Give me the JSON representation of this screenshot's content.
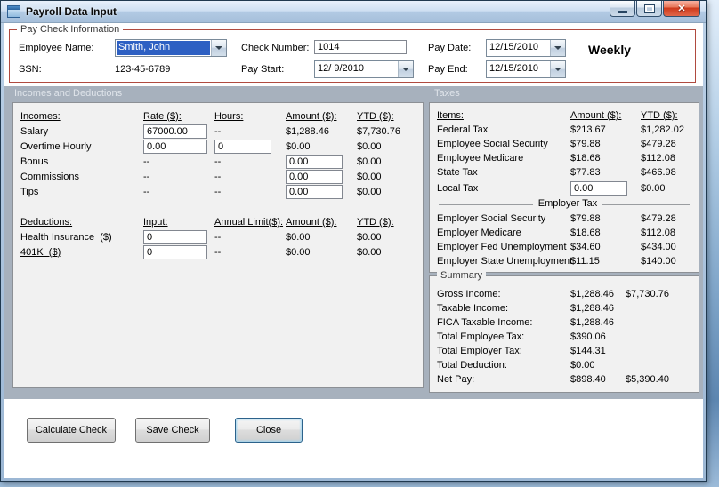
{
  "colors": {
    "desktop_blue": "#7fa5c9",
    "titlebar_top": "#e7f0fb",
    "band_background": "#a7b1bd",
    "panel_background": "#f1f1f1",
    "paycheck_group_border": "#b04a3f",
    "selection_blue": "#2e60c3",
    "close_button_red": "#ce3a1c"
  },
  "window": {
    "title": "Payroll Data Input"
  },
  "icons": {
    "close_glyph": "✕"
  },
  "paycheck": {
    "group_label": "Pay Check Information",
    "fields": {
      "employee_name": {
        "label": "Employee Name:",
        "value": "Smith, John"
      },
      "ssn": {
        "label": "SSN:",
        "value": "123-45-6789"
      },
      "check_number": {
        "label": "Check Number:",
        "value": "1014"
      },
      "pay_start": {
        "label": "Pay Start:",
        "value": "12/ 9/2010"
      },
      "pay_date": {
        "label": "Pay Date:",
        "value": "12/15/2010"
      },
      "pay_end": {
        "label": "Pay End:",
        "value": "12/15/2010"
      }
    },
    "frequency": "Weekly"
  },
  "sections": {
    "incomes_and_deductions": "Incomes and Deductions",
    "taxes": "Taxes"
  },
  "incomes": {
    "headers": {
      "name": "Incomes:",
      "rate": "Rate ($):",
      "hours": "Hours:",
      "amount": "Amount ($):",
      "ytd": "YTD ($):"
    },
    "rows": [
      {
        "label": "Salary",
        "rate": "67000.00",
        "hours": "--",
        "amount": "$1,288.46",
        "ytd": "$7,730.76"
      },
      {
        "label": "Overtime Hourly",
        "rate": "0.00",
        "hours": "0",
        "amount": "$0.00",
        "ytd": "$0.00"
      },
      {
        "label": "Bonus",
        "rate": "--",
        "hours": "--",
        "amount": "0.00",
        "ytd": "$0.00"
      },
      {
        "label": "Commissions",
        "rate": "--",
        "hours": "--",
        "amount": "0.00",
        "ytd": "$0.00"
      },
      {
        "label": "Tips",
        "rate": "--",
        "hours": "--",
        "amount": "0.00",
        "ytd": "$0.00"
      }
    ]
  },
  "deductions": {
    "headers": {
      "name": "Deductions:",
      "input": "Input:",
      "annual_limit": "Annual Limit($):",
      "amount": "Amount ($):",
      "ytd": "YTD ($):"
    },
    "rows": [
      {
        "label": "Health Insurance  ($)",
        "input": "0",
        "annual_limit": "--",
        "amount": "$0.00",
        "ytd": "$0.00"
      },
      {
        "label": "401K  ($)",
        "input": "0",
        "annual_limit": "--",
        "amount": "$0.00",
        "ytd": "$0.00"
      }
    ]
  },
  "taxes": {
    "headers": {
      "items": "Items:",
      "amount": "Amount ($):",
      "ytd": "YTD ($):"
    },
    "employee_rows": [
      {
        "label": "Federal Tax",
        "amount": "$213.67",
        "ytd": "$1,282.02"
      },
      {
        "label": "Employee Social Security",
        "amount": "$79.88",
        "ytd": "$479.28"
      },
      {
        "label": "Employee Medicare",
        "amount": "$18.68",
        "ytd": "$112.08"
      },
      {
        "label": "State Tax",
        "amount": "$77.83",
        "ytd": "$466.98"
      }
    ],
    "local_tax": {
      "label": "Local Tax",
      "amount": "0.00",
      "ytd": "$0.00"
    },
    "employer_header": "Employer Tax",
    "employer_rows": [
      {
        "label": "Employer Social Security",
        "amount": "$79.88",
        "ytd": "$479.28"
      },
      {
        "label": "Employer Medicare",
        "amount": "$18.68",
        "ytd": "$112.08"
      },
      {
        "label": "Employer Fed Unemployment",
        "amount": "$34.60",
        "ytd": "$434.00"
      },
      {
        "label": "Employer State Unemployment",
        "amount": "$11.15",
        "ytd": "$140.00"
      }
    ]
  },
  "summary": {
    "group_label": "Summary",
    "rows": [
      {
        "label": "Gross Income:",
        "value": "$1,288.46",
        "ytd": "$7,730.76"
      },
      {
        "label": "Taxable Income:",
        "value": "$1,288.46",
        "ytd": ""
      },
      {
        "label": "FICA Taxable Income:",
        "value": "$1,288.46",
        "ytd": ""
      },
      {
        "label": "Total Employee Tax:",
        "value": "$390.06",
        "ytd": ""
      },
      {
        "label": "Total Employer Tax:",
        "value": "$144.31",
        "ytd": ""
      },
      {
        "label": "Total Deduction:",
        "value": "$0.00",
        "ytd": ""
      },
      {
        "label": "Net Pay:",
        "value": "$898.40",
        "ytd": "$5,390.40"
      }
    ]
  },
  "buttons": {
    "calculate": "Calculate Check",
    "save": "Save Check",
    "close": "Close"
  }
}
